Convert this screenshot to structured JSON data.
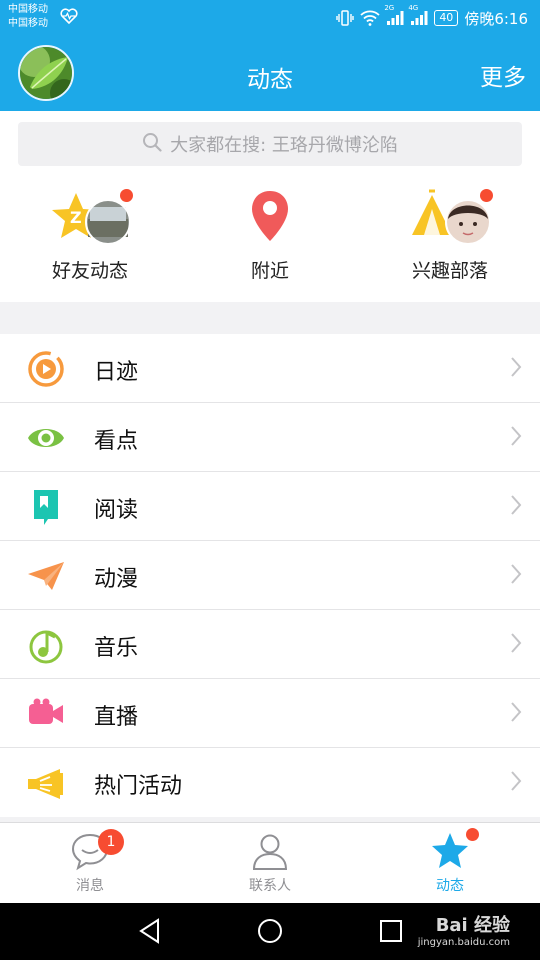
{
  "status_bar": {
    "carrier_1": "中国移动",
    "carrier_2": "中国移动",
    "network_1": "2G",
    "network_2": "4G",
    "battery": "40",
    "time": "傍晚6:16"
  },
  "header": {
    "title": "动态",
    "more_label": "更多",
    "avatar_icon": "leaf-avatar-icon"
  },
  "search": {
    "placeholder": "大家都在搜: 王珞丹微博沦陷"
  },
  "quick_entries": [
    {
      "label": "好友动态",
      "icon": "qzone-star-icon",
      "has_dot": true
    },
    {
      "label": "附近",
      "icon": "location-pin-icon",
      "has_dot": false
    },
    {
      "label": "兴趣部落",
      "icon": "tribe-tent-icon",
      "has_dot": true
    }
  ],
  "list": [
    {
      "label": "日迹",
      "icon": "play-circle-icon",
      "color": "#f79a3d"
    },
    {
      "label": "看点",
      "icon": "eye-icon",
      "color": "#7ac143"
    },
    {
      "label": "阅读",
      "icon": "book-icon",
      "color": "#1cc5b1"
    },
    {
      "label": "动漫",
      "icon": "paper-plane-icon",
      "color": "#f7934c"
    },
    {
      "label": "音乐",
      "icon": "music-note-icon",
      "color": "#8dc63f"
    },
    {
      "label": "直播",
      "icon": "video-camera-icon",
      "color": "#f55f93"
    },
    {
      "label": "热门活动",
      "icon": "megaphone-icon",
      "color": "#f8c425"
    }
  ],
  "tabs": [
    {
      "label": "消息",
      "icon": "chat-bubble-icon",
      "badge": "1",
      "active": false
    },
    {
      "label": "联系人",
      "icon": "person-icon",
      "badge": "",
      "active": false
    },
    {
      "label": "动态",
      "icon": "star-icon",
      "badge": "",
      "active": true
    }
  ],
  "watermark": {
    "brand": "Bai 经验",
    "url": "jingyan.baidu.com"
  },
  "colors": {
    "accent": "#1da9e8",
    "badge": "#f74c31"
  }
}
